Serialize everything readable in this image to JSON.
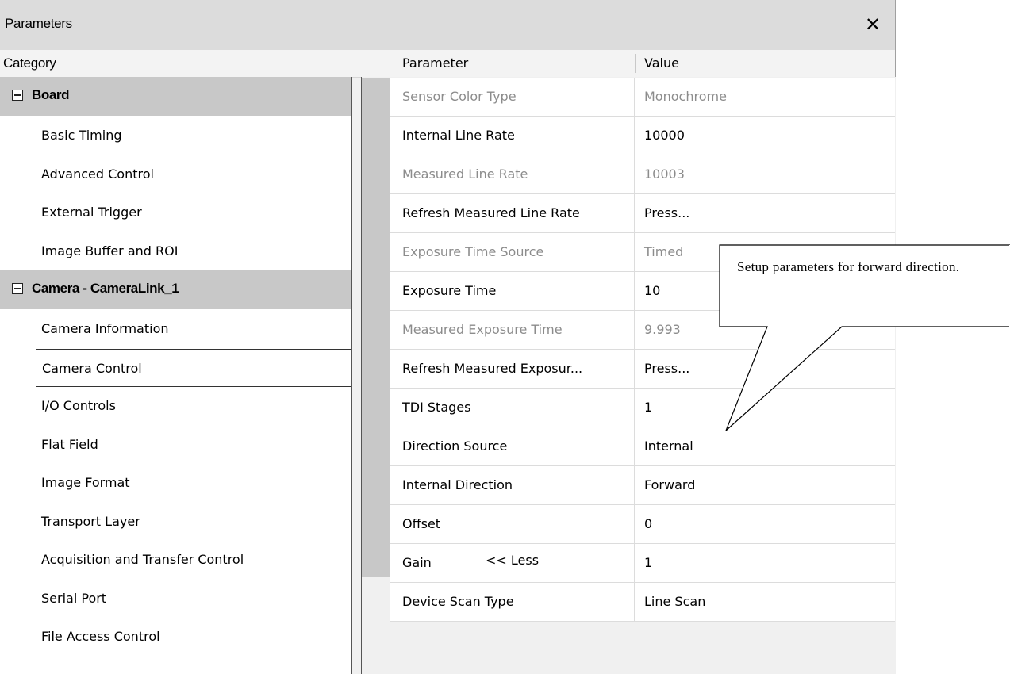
{
  "window": {
    "title": "Parameters",
    "close_glyph": "✕"
  },
  "headers": {
    "category": "Category",
    "parameter": "Parameter",
    "value": "Value"
  },
  "categories": {
    "board_label": "Board",
    "board_items": [
      "Basic Timing",
      "Advanced Control",
      "External Trigger",
      "Image Buffer and ROI"
    ],
    "camera_label": "Camera - CameraLink_1",
    "camera_items": [
      "Camera Information",
      "Camera Control",
      "I/O Controls",
      "Flat Field",
      "Image Format",
      "Transport Layer",
      "Acquisition and Transfer Control",
      "Serial Port",
      "File Access Control"
    ],
    "selected": "Camera Control"
  },
  "parameters": [
    {
      "name": "Sensor Color Type",
      "value": "Monochrome",
      "enabled": false
    },
    {
      "name": "Internal Line Rate",
      "value": "10000",
      "enabled": true
    },
    {
      "name": "Measured Line Rate",
      "value": "10003",
      "enabled": false
    },
    {
      "name": "Refresh Measured Line Rate",
      "value": "Press...",
      "enabled": true
    },
    {
      "name": "Exposure Time Source",
      "value": "Timed",
      "enabled": false
    },
    {
      "name": "Exposure Time",
      "value": "10",
      "enabled": true
    },
    {
      "name": "Measured Exposure Time",
      "value": "9.993",
      "enabled": false
    },
    {
      "name": "Refresh Measured Exposur...",
      "value": "Press...",
      "enabled": true
    },
    {
      "name": "TDI Stages",
      "value": "1",
      "enabled": true
    },
    {
      "name": "Direction Source",
      "value": "Internal",
      "enabled": true
    },
    {
      "name": "Internal Direction",
      "value": "Forward",
      "enabled": true
    },
    {
      "name": "Offset",
      "value": "0",
      "enabled": true
    },
    {
      "name": "Gain",
      "value": "1",
      "enabled": true
    },
    {
      "name": "Device Scan Type",
      "value": "Line Scan",
      "enabled": true
    }
  ],
  "less_link": "<< Less",
  "callout": {
    "text": "Setup parameters for forward direction."
  }
}
